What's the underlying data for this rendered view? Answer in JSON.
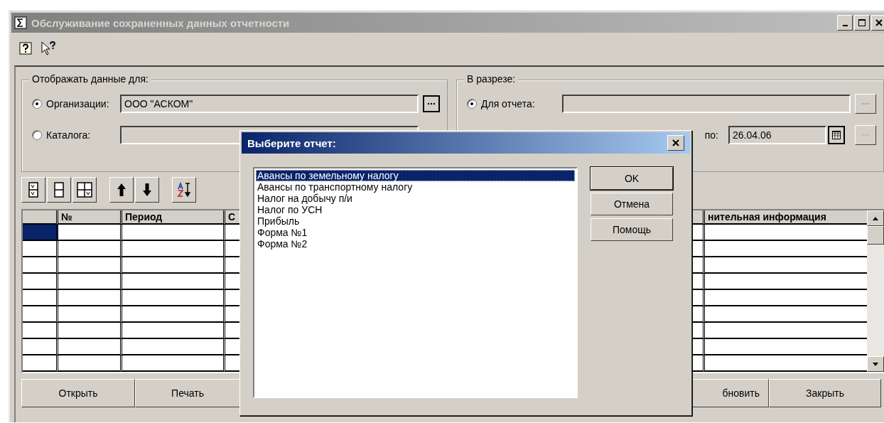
{
  "window": {
    "title": "Обслуживание сохраненных данных отчетности"
  },
  "display_for": {
    "title": "Отображать данные для:",
    "options": [
      {
        "label": "Организации:",
        "selected": true,
        "value": "ООО \"АСКОМ\""
      },
      {
        "label": "Каталога:",
        "selected": false
      }
    ]
  },
  "slice": {
    "title": "В разрезе:",
    "options": [
      {
        "label": "Для отчета:",
        "selected": true
      }
    ],
    "to_label": "по:",
    "to_date": "26.04.06"
  },
  "table": {
    "columns": [
      "№",
      "Период",
      "С",
      "нительная информация"
    ],
    "rows": [
      {
        "selected": true
      },
      {
        "selected": false
      },
      {
        "selected": false
      },
      {
        "selected": false
      },
      {
        "selected": false
      },
      {
        "selected": false
      },
      {
        "selected": false
      },
      {
        "selected": false
      },
      {
        "selected": false
      }
    ]
  },
  "buttons": [
    "Открыть",
    "Печать",
    "бновить",
    "Закрыть"
  ],
  "dialog": {
    "title": "Выберите отчет:",
    "items": [
      {
        "label": "Авансы по земельному налогу",
        "selected": true
      },
      {
        "label": "Авансы по транспортному налогу",
        "selected": false
      },
      {
        "label": "Налог на добычу п/и",
        "selected": false
      },
      {
        "label": "Налог по УСН",
        "selected": false
      },
      {
        "label": "Прибыль",
        "selected": false
      },
      {
        "label": "Форма №1",
        "selected": false
      },
      {
        "label": "Форма №2",
        "selected": false
      }
    ],
    "buttons": [
      "OK",
      "Отмена",
      "Помощь"
    ]
  }
}
